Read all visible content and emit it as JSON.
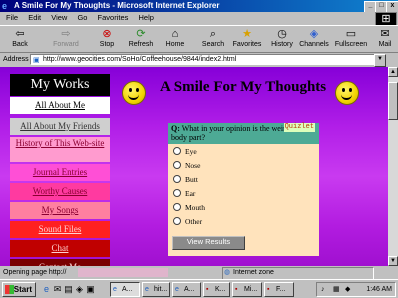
{
  "window": {
    "title": "A Smile For My Thoughts - Microsoft Internet Explorer"
  },
  "menu": [
    "File",
    "Edit",
    "View",
    "Go",
    "Favorites",
    "Help"
  ],
  "toolbar": {
    "back": "Back",
    "forward": "Forward",
    "stop": "Stop",
    "refresh": "Refresh",
    "home": "Home",
    "search": "Search",
    "favorites": "Favorites",
    "history": "History",
    "channels": "Channels",
    "fullscreen": "Fullscreen",
    "mail": "Mail"
  },
  "address": {
    "label": "Address",
    "url": "http://www.geocities.com/SoHo/Coffeehouse/9844/index2.html"
  },
  "page": {
    "title": "A Smile For My Thoughts",
    "nav_title": "My Works",
    "nav_items": [
      {
        "label": "All About Me",
        "bg": "#ffffff"
      },
      {
        "label": "All About My Friends",
        "bg": "#cfcfcf"
      },
      {
        "label": "History of This Web-site",
        "bg": "#ff9bcf"
      },
      {
        "label": "Journal Entries",
        "bg": "#ff4fd6"
      },
      {
        "label": "Worthy Causes",
        "bg": "#ff3aa0"
      },
      {
        "label": "My Songs",
        "bg": "#ff7fa0"
      },
      {
        "label": "Sound Files",
        "bg": "#ff2020"
      },
      {
        "label": "Chat",
        "bg": "#c00000"
      },
      {
        "label": "Contact Me",
        "bg": "#7a0000"
      }
    ]
  },
  "poll": {
    "badge": "Quizlet",
    "q_prefix": "Q:",
    "question": "What in your opinion is the weirdest body part?",
    "options": [
      "Eye",
      "Nose",
      "Butt",
      "Ear",
      "Mouth",
      "Other"
    ],
    "button": "View Results"
  },
  "status": {
    "text": "Opening page http://",
    "zone": "Internet zone"
  },
  "taskbar": {
    "start": "Start",
    "tasks": [
      {
        "label": "A...",
        "icon": "ie-icon"
      },
      {
        "label": "hit...",
        "icon": "ie-icon"
      },
      {
        "label": "A...",
        "icon": "ie-icon"
      },
      {
        "label": "K...",
        "icon": "app-icon"
      },
      {
        "label": "Mi...",
        "icon": "app-icon"
      },
      {
        "label": "F...",
        "icon": "app-icon"
      }
    ],
    "clock": "1:46 AM"
  }
}
